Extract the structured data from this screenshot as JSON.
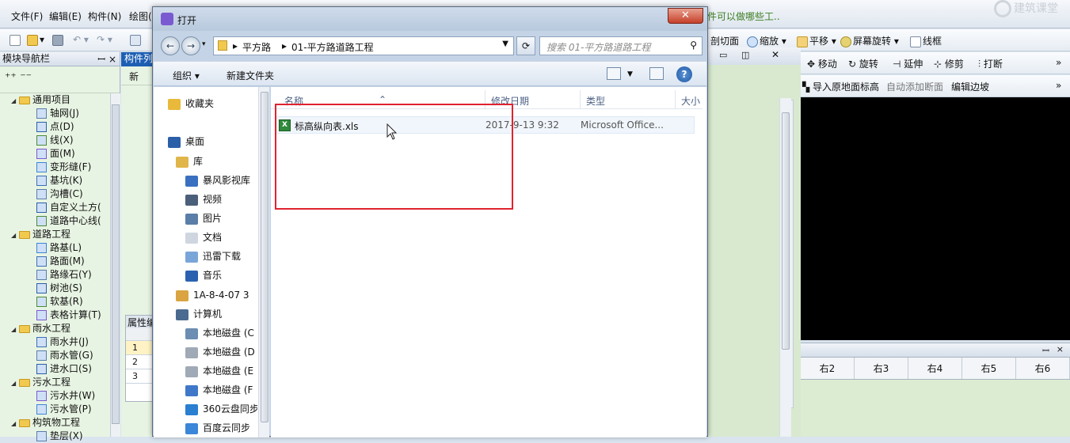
{
  "app": {
    "menu": [
      "文件(F)",
      "编辑(E)",
      "构件(N)",
      "绘图("
    ],
    "hint": "件可以做哪些工..",
    "watermark": "建筑课堂",
    "toolbar_right": [
      "剖切面",
      "缩放",
      "平移",
      "屏幕旋转",
      "线框"
    ],
    "toolbar_right2": [
      "移动",
      "旋转",
      "延伸",
      "修剪",
      "打断"
    ],
    "toolbar_right3": [
      "导入原地面标高",
      "自动添加断面",
      "编辑边坡"
    ],
    "grid_columns": [
      "右2",
      "右3",
      "右4",
      "右5",
      "右6"
    ]
  },
  "nav": {
    "title": "模块导航栏",
    "pin": "ꟷ",
    "close": "×",
    "tree": [
      {
        "label": "通用项目",
        "level": 0,
        "folder": true
      },
      {
        "label": "轴网(J)",
        "level": 1
      },
      {
        "label": "点(D)",
        "level": 1
      },
      {
        "label": "线(X)",
        "level": 1
      },
      {
        "label": "面(M)",
        "level": 1
      },
      {
        "label": "变形缝(F)",
        "level": 1
      },
      {
        "label": "基坑(K)",
        "level": 1
      },
      {
        "label": "沟槽(C)",
        "level": 1
      },
      {
        "label": "自定义土方(",
        "level": 1
      },
      {
        "label": "道路中心线(",
        "level": 1
      },
      {
        "label": "道路工程",
        "level": 0,
        "folder": true
      },
      {
        "label": "路基(L)",
        "level": 1
      },
      {
        "label": "路面(M)",
        "level": 1
      },
      {
        "label": "路缘石(Y)",
        "level": 1
      },
      {
        "label": "树池(S)",
        "level": 1
      },
      {
        "label": "软基(R)",
        "level": 1
      },
      {
        "label": "表格计算(T)",
        "level": 1
      },
      {
        "label": "雨水工程",
        "level": 0,
        "folder": true
      },
      {
        "label": "雨水井(J)",
        "level": 1
      },
      {
        "label": "雨水管(G)",
        "level": 1
      },
      {
        "label": "进水口(S)",
        "level": 1
      },
      {
        "label": "污水工程",
        "level": 0,
        "folder": true
      },
      {
        "label": "污水井(W)",
        "level": 1
      },
      {
        "label": "污水管(P)",
        "level": 1
      },
      {
        "label": "构筑物工程",
        "level": 0,
        "folder": true
      },
      {
        "label": "垫层(X)",
        "level": 1
      }
    ]
  },
  "mid": {
    "title": "构件列",
    "new": "新",
    "prop": "属性编",
    "rows": [
      "1",
      "2",
      "3"
    ]
  },
  "dialog": {
    "title": "打开",
    "close": "✕",
    "breadcrumb": [
      "平方路",
      "01-平方路道路工程"
    ],
    "search_placeholder": "搜索 01-平方路道路工程",
    "organize": "组织 ▾",
    "new_folder": "新建文件夹",
    "left": [
      {
        "label": "收藏夹",
        "color": "#e8b93a"
      },
      {
        "label": "桌面",
        "color": "#2b5fa8"
      },
      {
        "label": "库",
        "color": "#e0b54a"
      },
      {
        "label": "暴风影视库",
        "color": "#3a70c0"
      },
      {
        "label": "视频",
        "color": "#4b5f7a"
      },
      {
        "label": "图片",
        "color": "#5a7ea8"
      },
      {
        "label": "文档",
        "color": "#cfd6df"
      },
      {
        "label": "迅雷下载",
        "color": "#7aa5d8"
      },
      {
        "label": "音乐",
        "color": "#2a62b0"
      },
      {
        "label": "1A-8-4-07 3",
        "color": "#d9a441"
      },
      {
        "label": "计算机",
        "color": "#4b6a90"
      },
      {
        "label": "本地磁盘 (C",
        "color": "#6d8db3"
      },
      {
        "label": "本地磁盘 (D",
        "color": "#a0aab6"
      },
      {
        "label": "本地磁盘 (E",
        "color": "#a0aab6"
      },
      {
        "label": "本地磁盘 (F",
        "color": "#3f78c8"
      },
      {
        "label": "360云盘同步",
        "color": "#2a7fd1"
      },
      {
        "label": "百度云同步",
        "color": "#3a86d8"
      }
    ],
    "columns": [
      "名称",
      "修改日期",
      "类型",
      "大小"
    ],
    "files": [
      {
        "name": "标高纵向表.xls",
        "date": "2017-9-13 9:32",
        "type": "Microsoft Office..."
      }
    ]
  }
}
